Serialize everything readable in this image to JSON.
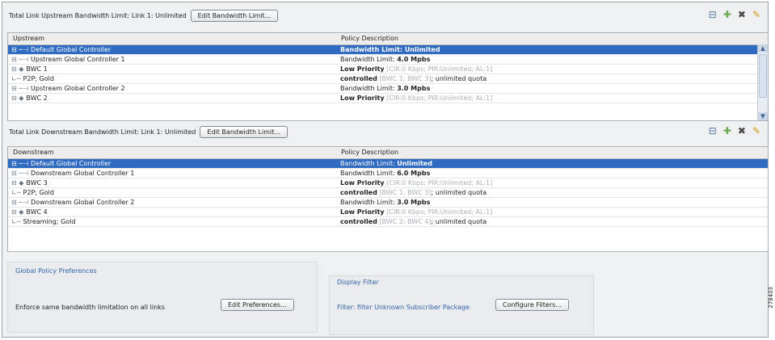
{
  "upstream": {
    "limit_label": "Total Link Upstream Bandwidth Limit: Link 1: Unlimited",
    "edit_button": "Edit Bandwidth Limit...",
    "columns": [
      "Upstream",
      "Policy Description"
    ],
    "rows": [
      {
        "tree": "⊟ ─⊣",
        "name": "Default Global Controller",
        "pre": "",
        "strong": "Bandwidth Limit: ",
        "bold": "Unlimited",
        "gray": "",
        "post": "",
        "selected": true
      },
      {
        "tree": "⊟ ─⊣",
        "name": "Upstream Global Controller 1",
        "pre": "Bandwidth Limit: ",
        "bold": "4.0 Mpbs",
        "gray": "",
        "post": ""
      },
      {
        "tree": "   ⊟ ◆",
        "name": "BWC 1",
        "pre": "",
        "bold": "Low Priority",
        "gray": " [CIR:0 Kbps; PIR:Unlimited; AL:1]",
        "post": ""
      },
      {
        "tree": "      ∟─",
        "name": "P2P; Gold",
        "pre": "",
        "bold": "controlled",
        "gray": " [BWC 1; BWC 3]",
        "post": "; unlimited quota"
      },
      {
        "tree": "⊟ ─⊣",
        "name": "Upstream Global Controller 2",
        "pre": "Bandwidth Limit: ",
        "bold": "3.0 Mpbs",
        "gray": "",
        "post": ""
      },
      {
        "tree": "   ⊟ ◆",
        "name": "BWC 2",
        "pre": "",
        "bold": "Low Priority",
        "gray": " [CIR:0 Kbps; PIR:Unlimited; AL:1]",
        "post": ""
      }
    ]
  },
  "downstream": {
    "limit_label": "Total Link Downstream Bandwidth Limit: Link 1: Unlimited",
    "edit_button": "Edit Bandwidth Limit...",
    "columns": [
      "Downstream",
      "Policy Description"
    ],
    "rows": [
      {
        "tree": "⊟ ─⊣",
        "name": "Default Global Controller",
        "pre": "Bandwidth Limit: ",
        "bold": "Unlimited",
        "gray": "",
        "post": "",
        "selected": true
      },
      {
        "tree": "⊟ ─⊣",
        "name": "Downstream Global Controller 1",
        "pre": "Bandwidth Limit: ",
        "bold": "6.0 Mpbs",
        "gray": "",
        "post": ""
      },
      {
        "tree": "   ⊟ ◆",
        "name": "BWC 3",
        "pre": "",
        "bold": "Low Priority",
        "gray": " [CIR:0 Kbps; PIR:Unlimited; AL:1]",
        "post": ""
      },
      {
        "tree": "      ∟─",
        "name": "P2P; Gold",
        "pre": "",
        "bold": "controlled",
        "gray": " [BWC 1; BWC 3]",
        "post": "; unlimited quota"
      },
      {
        "tree": "⊟ ─⊣",
        "name": "Downstream Global Controller 2",
        "pre": "Bandwidth Limit: ",
        "bold": "3.0 Mpbs",
        "gray": "",
        "post": ""
      },
      {
        "tree": "   ⊟ ◆",
        "name": "BWC 4",
        "pre": "",
        "bold": "Low Priority",
        "gray": " [CIR:0 Kbps; PIR:Unlimited; AL:1]",
        "post": ""
      },
      {
        "tree": "      ∟─",
        "name": "Streaming; Gold",
        "pre": "",
        "bold": "controlled",
        "gray": " [BWC 2; BWC 4]",
        "post": "; unlimited quota"
      }
    ]
  },
  "toolbar_icons": [
    "collapse-icon",
    "add-icon",
    "delete-icon",
    "edit-icon"
  ],
  "global_policy": {
    "title": "Global Policy Preferences",
    "text": "Enforce same bandwidth limitation on all links",
    "button": "Edit Preferences..."
  },
  "display_filter": {
    "title": "Display Filter",
    "text": "Filter: filter Unknown Subscriber Package",
    "button": "Configure Filters..."
  },
  "watermark": "278403",
  "colors": {
    "selection": "#2f6bc1",
    "accent": "#3366aa"
  }
}
